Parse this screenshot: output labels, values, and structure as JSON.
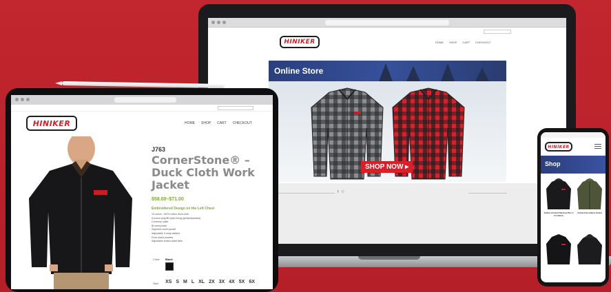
{
  "brand": {
    "logo_text": "HINIKER",
    "accent": "#d0202a",
    "background": "#b8232b"
  },
  "laptop": {
    "nav": [
      "HOME",
      "SHOP",
      "CART",
      "CHECKOUT"
    ],
    "hero_title": "Online Store",
    "cta_label": "SHOP NOW",
    "social": [
      "f",
      "☉"
    ]
  },
  "tablet": {
    "nav": [
      "HOME",
      "SHOP",
      "CART",
      "CHECKOUT"
    ],
    "product_code": "J763",
    "product_title": "CornerStone® – Duck Cloth Work Jacket",
    "price": "$58.00–$71.00",
    "embroidery_note": "Embroidered Design on the Left Chest",
    "bullets": [
      "12-ounce, 100% cotton duck cloth",
      "6-ounce poly/fill nylon lining (quilted/padded)",
      "Corduroy collar",
      "Bi-swing back",
      "Zippered chest pocket",
      "Adjustable 2-snap tabbed",
      "Front slash pockets",
      "Adjustable button waist tabs"
    ],
    "color_label": "Color:",
    "color_value": "Black",
    "size_label": "Size:",
    "sizes": [
      "XS",
      "S",
      "M",
      "L",
      "XL",
      "2X",
      "3X",
      "4X",
      "5X",
      "6X"
    ]
  },
  "phone": {
    "banner_title": "Shop",
    "products": [
      {
        "caption": "Jacket Hooded Ripstop Plus 2 Insulated"
      },
      {
        "caption": "Carhartt Insulated Jacket"
      }
    ]
  }
}
